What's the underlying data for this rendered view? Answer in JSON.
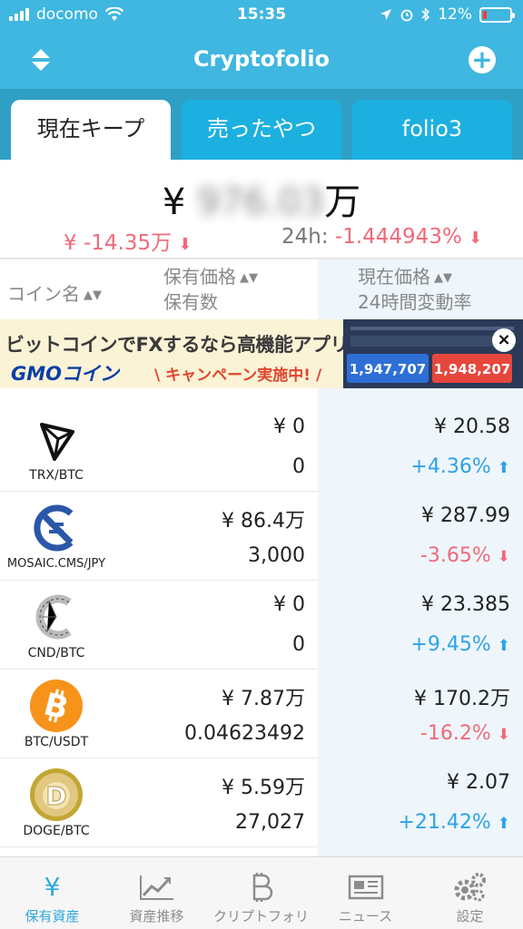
{
  "status_bar": {
    "carrier": "docomo",
    "time": "15:35",
    "battery": "12%"
  },
  "navbar": {
    "title": "Cryptofolio"
  },
  "tabs": [
    {
      "label": "現在キープ",
      "active": true
    },
    {
      "label": "売ったやつ",
      "active": false
    },
    {
      "label": "folio3",
      "active": false
    }
  ],
  "total": {
    "currency": "¥",
    "amount_obscured": "976.03",
    "unit": "万",
    "change": "¥ -14.35万",
    "h24_label": "24h:",
    "h24_value": "-1.444943%"
  },
  "table_header": {
    "coin_name": "コイン名",
    "held_price": "保有価格",
    "held_qty": "保有数",
    "current_price": "現在価格",
    "change_24h": "24時間変動率"
  },
  "ad": {
    "line1": "ビットコインでFXするなら高機能アプリで!",
    "logo": "GMOコイン",
    "line2": "\\ キャンペーン実施中! /",
    "bid_price": "1,947,707",
    "ask_price": "1,948,207",
    "close": "×"
  },
  "coins": [
    {
      "pair": "TRX/BTC",
      "held_price": "¥ 0",
      "held_qty": "0",
      "current_price": "¥ 20.58",
      "change": "+4.36%",
      "direction": "up"
    },
    {
      "pair": "MOSAIC.CMS/JPY",
      "held_price": "¥ 86.4万",
      "held_qty": "3,000",
      "current_price": "¥ 287.99",
      "change": "-3.65%",
      "direction": "down"
    },
    {
      "pair": "CND/BTC",
      "held_price": "¥ 0",
      "held_qty": "0",
      "current_price": "¥ 23.385",
      "change": "+9.45%",
      "direction": "up"
    },
    {
      "pair": "BTC/USDT",
      "held_price": "¥ 7.87万",
      "held_qty": "0.04623492",
      "current_price": "¥ 170.2万",
      "change": "-16.2%",
      "direction": "down"
    },
    {
      "pair": "DOGE/BTC",
      "held_price": "¥ 5.59万",
      "held_qty": "27,027",
      "current_price": "¥ 2.07",
      "change": "+21.42%",
      "direction": "up"
    }
  ],
  "bottom_tabs": [
    {
      "label": "保有資産",
      "icon": "yen-icon",
      "active": true
    },
    {
      "label": "資産推移",
      "icon": "chart-icon",
      "active": false
    },
    {
      "label": "クリプトフォリオ",
      "icon": "bitcoin-icon",
      "active": false
    },
    {
      "label": "ニュース",
      "icon": "newspaper-icon",
      "active": false
    },
    {
      "label": "設定",
      "icon": "gears-icon",
      "active": false
    }
  ],
  "colors": {
    "header": "#3fb7e0",
    "tab_bar": "#2f9fc6",
    "negative": "#f06a7a",
    "positive": "#2ea2e8",
    "active_tab": "#2fa8db"
  }
}
